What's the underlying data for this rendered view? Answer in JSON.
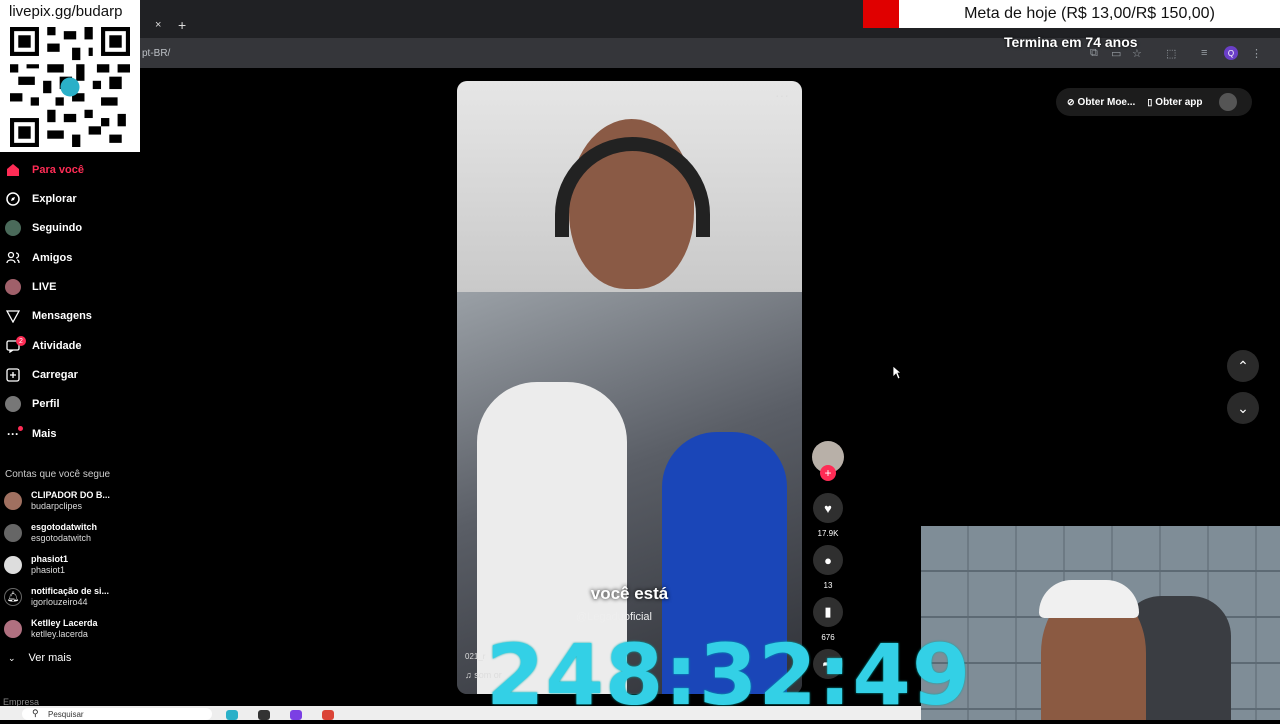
{
  "browser": {
    "url": "pt-BR/",
    "close_tab_glyph": "×",
    "new_tab_glyph": "+",
    "profile_initial": "Q"
  },
  "stream_overlay": {
    "livepix_label": "livepix.gg/budarp",
    "goal_text": "Meta de hoje (R$ 13,00/R$ 150,00)",
    "ends_text": "Termina em 74 anos",
    "timer": "248:32:49"
  },
  "sidebar": {
    "nav": [
      {
        "label": "Para você",
        "icon": "home-icon",
        "active": true
      },
      {
        "label": "Explorar",
        "icon": "compass-icon"
      },
      {
        "label": "Seguindo",
        "icon": "following-avatar-icon"
      },
      {
        "label": "Amigos",
        "icon": "friends-icon"
      },
      {
        "label": "LIVE",
        "icon": "live-avatar-icon"
      },
      {
        "label": "Mensagens",
        "icon": "send-icon"
      },
      {
        "label": "Atividade",
        "icon": "activity-icon",
        "badge": "2"
      },
      {
        "label": "Carregar",
        "icon": "upload-icon"
      },
      {
        "label": "Perfil",
        "icon": "profile-avatar-icon"
      },
      {
        "label": "Mais",
        "icon": "more-icon"
      }
    ],
    "following_header": "Contas que você segue",
    "accounts": [
      {
        "name": "CLIPADOR DO B...",
        "handle": "budarpclipes"
      },
      {
        "name": "esgotodatwitch",
        "handle": "esgotodatwitch"
      },
      {
        "name": "phasiot1",
        "handle": "phasiot1"
      },
      {
        "name": "notificação de si...",
        "handle": "igorlouzeiro44"
      },
      {
        "name": "Ketlley Lacerda",
        "handle": "ketlley.lacerda"
      }
    ],
    "see_more": "Ver mais",
    "footer": "Empresa"
  },
  "video": {
    "caption": "você está",
    "handle": "@Legaduoficial",
    "user": "021_r",
    "sound": "♫ som or",
    "menu_glyph": "···"
  },
  "actions": {
    "likes": "17.9K",
    "comments": "13",
    "saves": "676"
  },
  "top_actions": {
    "coins": "Obter Moe...",
    "app": "Obter app"
  },
  "taskbar": {
    "search_placeholder": "Pesquisar"
  },
  "colors": {
    "accent": "#fe2c55",
    "timer": "#33d0e6",
    "goal_red": "#e00000"
  }
}
